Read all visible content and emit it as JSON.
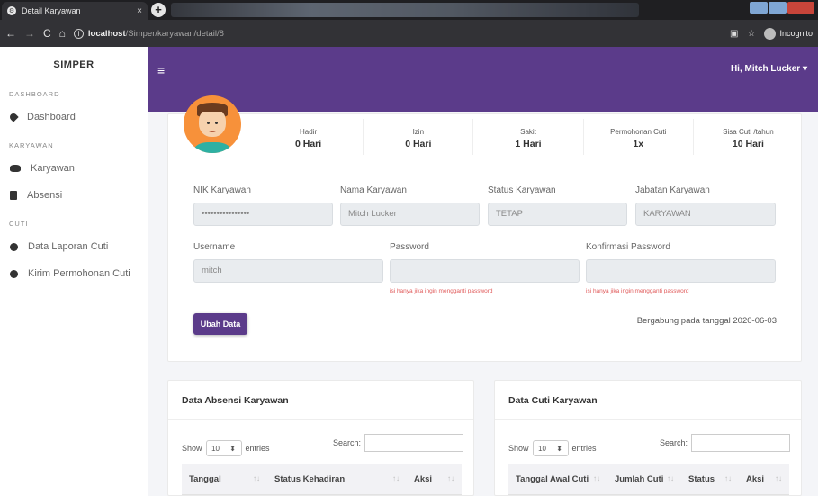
{
  "browser": {
    "tab_title": "Detail Karyawan",
    "tab_close": "×",
    "new_tab": "+",
    "url_host": "localhost",
    "url_path": "/Simper/karyawan/detail/8",
    "incognito_label": "Incognito"
  },
  "sidebar": {
    "brand": "SIMPER",
    "sections": [
      {
        "title": "DASHBOARD",
        "items": [
          {
            "label": "Dashboard",
            "icon": "dashboard-icon"
          }
        ]
      },
      {
        "title": "KARYAWAN",
        "items": [
          {
            "label": "Karyawan",
            "icon": "users-icon"
          },
          {
            "label": "Absensi",
            "icon": "book-icon"
          }
        ]
      },
      {
        "title": "CUTI",
        "items": [
          {
            "label": "Data Laporan Cuti",
            "icon": "dot-icon"
          },
          {
            "label": "Kirim Permohonan Cuti",
            "icon": "dot-icon"
          }
        ]
      }
    ]
  },
  "header": {
    "menu_icon": "≡",
    "user_label": "Hi, Mitch Lucker ▾",
    "color": "#5b3b8a"
  },
  "stats": [
    {
      "label": "Hadir",
      "value": "0 Hari"
    },
    {
      "label": "Izin",
      "value": "0 Hari"
    },
    {
      "label": "Sakit",
      "value": "1 Hari"
    },
    {
      "label": "Permohonan Cuti",
      "value": "1x"
    },
    {
      "label": "Sisa Cuti /tahun",
      "value": "10 Hari"
    }
  ],
  "form": {
    "nik_label": "NIK Karyawan",
    "nik_value": "••••••••••••••••",
    "nama_label": "Nama Karyawan",
    "nama_value": "Mitch Lucker",
    "status_label": "Status Karyawan",
    "status_value": "TETAP",
    "jabatan_label": "Jabatan Karyawan",
    "jabatan_value": "KARYAWAN",
    "username_label": "Username",
    "username_value": "mitch",
    "password_label": "Password",
    "konfirmasi_label": "Konfirmasi Password",
    "password_hint": "isi hanya jika ingin mengganti password",
    "konfirmasi_hint": "isi hanya jika ingin mengganti password",
    "submit_label": "Ubah Data",
    "joined_text": "Bergabung pada tanggal 2020-06-03"
  },
  "absensi_panel": {
    "title": "Data Absensi Karyawan",
    "show_label": "Show",
    "entries_value": "10",
    "entries_label": "entries",
    "search_label": "Search:",
    "columns": [
      "Tanggal",
      "Status Kehadiran",
      "Aksi"
    ]
  },
  "cuti_panel": {
    "title": "Data Cuti Karyawan",
    "show_label": "Show",
    "entries_value": "10",
    "entries_label": "entries",
    "search_label": "Search:",
    "columns": [
      "Tanggal Awal Cuti",
      "Jumlah Cuti",
      "Status",
      "Aksi"
    ]
  }
}
